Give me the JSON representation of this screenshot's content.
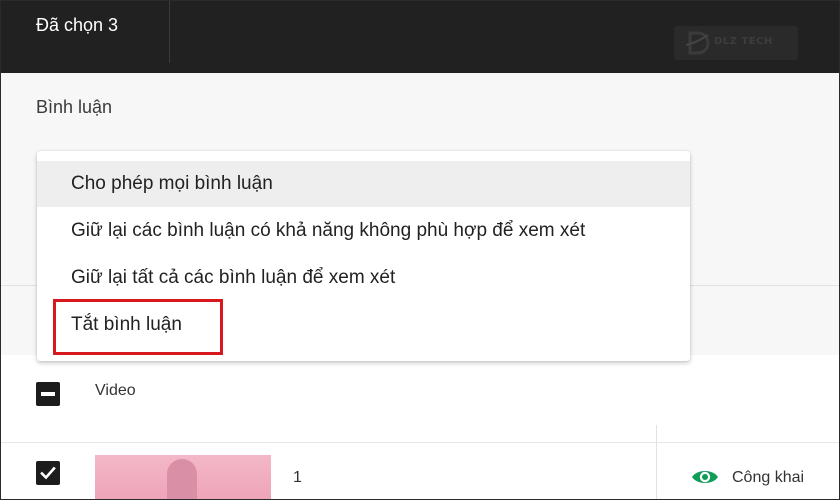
{
  "topbar": {
    "selected_count_text": "Đã chọn 3",
    "logo_text": "DLZ TECH"
  },
  "panel": {
    "section_label": "Bình luận"
  },
  "menu": {
    "items": [
      {
        "label": "Cho phép mọi bình luận"
      },
      {
        "label": "Giữ lại các bình luận có khả năng không phù hợp để xem xét"
      },
      {
        "label": "Giữ lại tất cả các bình luận để xem xét"
      },
      {
        "label": "Tắt bình luận"
      }
    ],
    "selected_index": 0,
    "highlight_color": "#d7191f"
  },
  "table": {
    "header": {
      "column_label": "Video"
    },
    "rows": [
      {
        "number": "1",
        "visibility": "Công khai",
        "checked": true
      }
    ]
  },
  "colors": {
    "topbar_bg": "#212121",
    "visibility_icon": "#0f9d58"
  },
  "icons": {
    "visibility": "eye-icon",
    "logo": "dlz-logo-icon"
  }
}
